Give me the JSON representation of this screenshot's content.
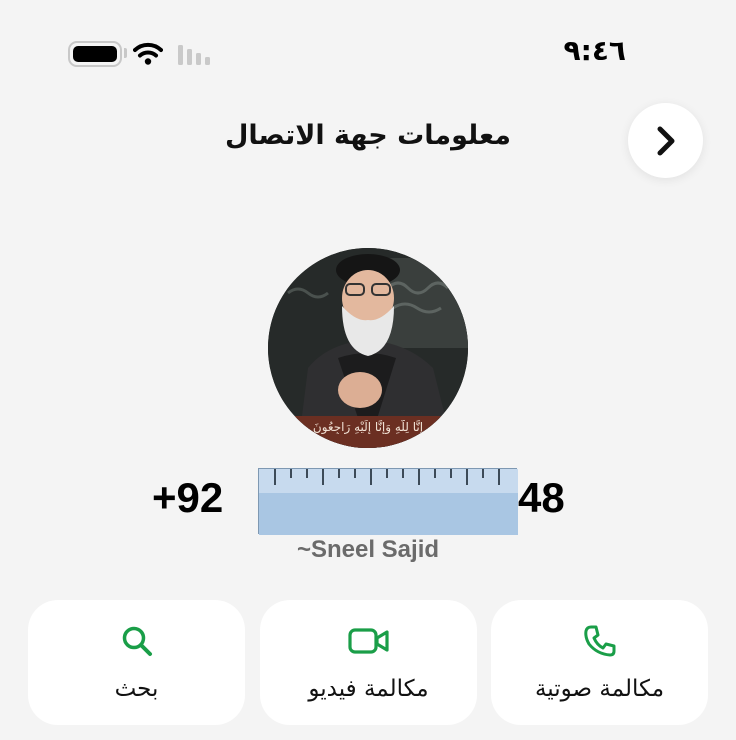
{
  "status_bar": {
    "time": "٩:٤٦",
    "battery_level": 1.0,
    "wifi_icon": "wifi-icon",
    "signal_icon": "cellular-signal-icon"
  },
  "header": {
    "title": "معلومات جهة الاتصال",
    "back_icon": "chevron-right-icon"
  },
  "contact": {
    "phone_prefix": "+92",
    "phone_suffix": "48",
    "name": "~Sneel Sajid",
    "avatar_caption": "إِنَّا لِلَّهِ وَإِنَّا إِلَيْهِ رَاجِعُونَ"
  },
  "actions": [
    {
      "label": "مكالمة صوتية",
      "icon": "phone-icon"
    },
    {
      "label": "مكالمة فيديو",
      "icon": "video-camera-icon"
    },
    {
      "label": "بحث",
      "icon": "search-icon"
    }
  ],
  "colors": {
    "accent": "#1a9e48",
    "background": "#f4f4f4",
    "card": "#ffffff",
    "redaction": "#a9c6e3"
  }
}
